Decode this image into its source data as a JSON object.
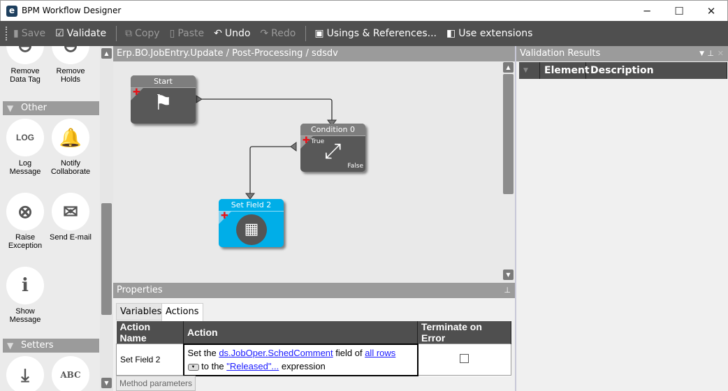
{
  "window": {
    "title": "BPM Workflow Designer",
    "app_icon": "e",
    "minimize": "─",
    "maximize": "☐",
    "close": "✕"
  },
  "toolbar": {
    "save": "Save",
    "validate": "Validate",
    "copy": "Copy",
    "paste": "Paste",
    "undo": "Undo",
    "redo": "Redo",
    "usings": "Usings & References...",
    "extensions": "Use extensions"
  },
  "palette": {
    "items_top": [
      {
        "label": "Remove Data Tag"
      },
      {
        "label": "Remove Holds"
      }
    ],
    "groups": {
      "other": "Other",
      "setters": "Setters"
    },
    "other_items": [
      {
        "label": "Log Message",
        "glyph": "LOG"
      },
      {
        "label": "Notify Collaborate",
        "glyph": "🔔"
      },
      {
        "label": "Raise Exception",
        "glyph": "⊗"
      },
      {
        "label": "Send E-mail",
        "glyph": "✉"
      },
      {
        "label": "Show Message",
        "glyph": "i"
      }
    ],
    "setter_glyphs": [
      "⤓",
      "ABC"
    ]
  },
  "canvas": {
    "breadcrumb": "Erp.BO.JobEntry.Update / Post-Processing / sdsdv",
    "nodes": {
      "start": "Start",
      "condition": "Condition 0",
      "setfield": "Set Field 2"
    },
    "condition_true": "True",
    "condition_false": "False",
    "colors": {
      "node": "#585858",
      "selected": "#00aee8"
    }
  },
  "properties": {
    "title": "Properties",
    "tabs": [
      "Variables",
      "Actions"
    ],
    "columns": [
      "Action Name",
      "Action",
      "Terminate on Error"
    ],
    "row": {
      "name": "Set Field 2",
      "t1": "Set the",
      "field": "ds.JobOper.SchedComment",
      "t2": "field of",
      "rows": "all rows",
      "t3": "to the",
      "expr": "\"Released\"...",
      "t4": "expression",
      "terminate": false
    },
    "method_parameters": "Method parameters"
  },
  "validation": {
    "title": "Validation Results",
    "columns": [
      "Element",
      "Description"
    ]
  }
}
